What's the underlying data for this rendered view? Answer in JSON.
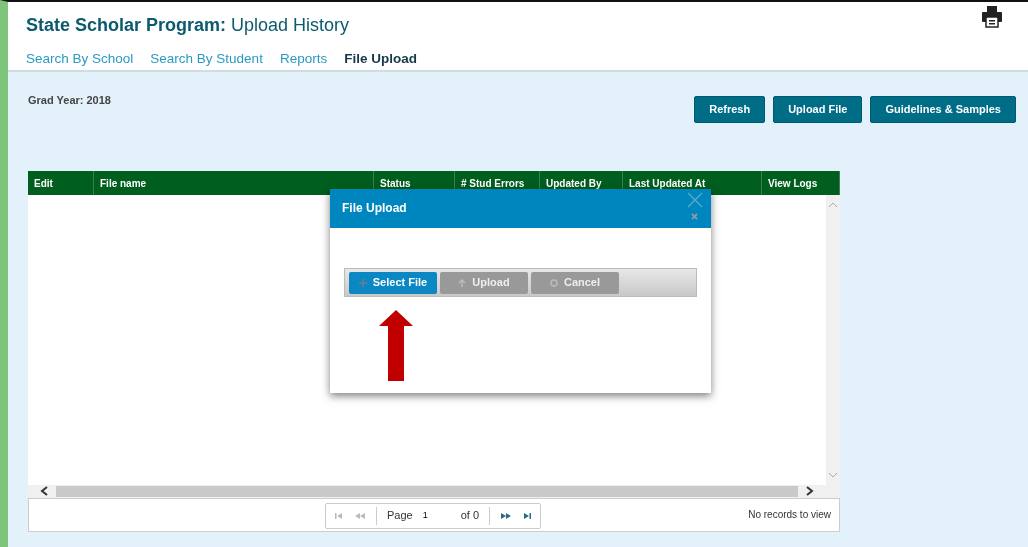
{
  "header": {
    "title_bold": "State Scholar Program:",
    "title_rest": "Upload History"
  },
  "tabs": [
    {
      "label": "Search By School",
      "selected": false
    },
    {
      "label": "Search By Student",
      "selected": false
    },
    {
      "label": "Reports",
      "selected": false
    },
    {
      "label": "File Upload",
      "selected": true
    }
  ],
  "grad_year": "Grad Year: 2018",
  "buttons": [
    "Refresh",
    "Upload File",
    "Guidelines & Samples"
  ],
  "table": {
    "columns": [
      "Edit",
      "File name",
      "Status",
      "# Stud Errors",
      "Updated By",
      "Last Updated At",
      "View Logs"
    ]
  },
  "pager": {
    "page_label": "Page",
    "page_value": "1",
    "of_label": "of 0",
    "records": "No records to view"
  },
  "dialog": {
    "title": "File Upload",
    "buttons": [
      {
        "label": "Select File",
        "disabled": false
      },
      {
        "label": "Upload",
        "disabled": true
      },
      {
        "label": "Cancel",
        "disabled": true
      }
    ]
  }
}
